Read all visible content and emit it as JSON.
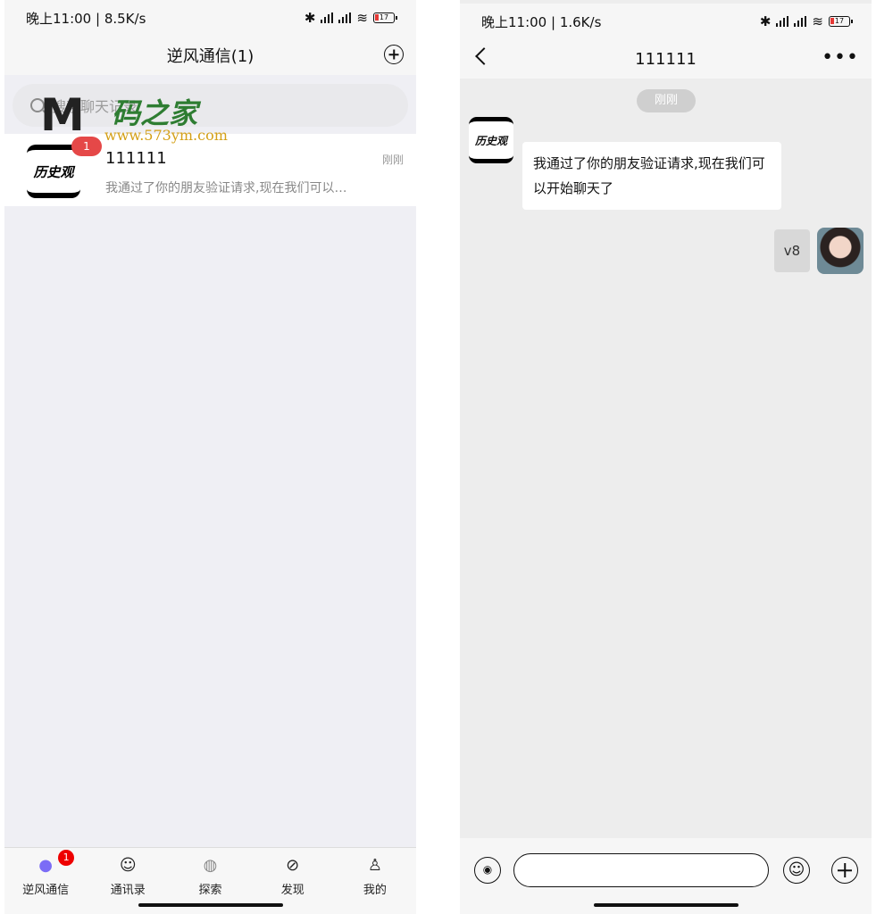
{
  "left": {
    "status": {
      "time": "晚上11:00",
      "speed": "8.5K/s",
      "battery": "17"
    },
    "header": {
      "title": "逆风通信(1)"
    },
    "search": {
      "placeholder": "搜索聊天记录"
    },
    "watermark": {
      "title": "码之家",
      "url": "www.573ym.com"
    },
    "chat_list": [
      {
        "name": "111111",
        "time": "刚刚",
        "preview": "我通过了你的朋友验证请求,现在我们可以…",
        "unread": "1",
        "avatar_text": "历史观"
      }
    ],
    "tabs": [
      {
        "label": "逆风通信",
        "icon": "chat-bubble-icon",
        "badge": "1"
      },
      {
        "label": "通讯录",
        "icon": "contacts-icon"
      },
      {
        "label": "探索",
        "icon": "planet-icon"
      },
      {
        "label": "发现",
        "icon": "compass-icon"
      },
      {
        "label": "我的",
        "icon": "profile-icon"
      }
    ]
  },
  "right": {
    "status": {
      "time": "晚上11:00",
      "speed": "1.6K/s",
      "battery": "17"
    },
    "header": {
      "title": "111111"
    },
    "time_pill": "刚刚",
    "messages": [
      {
        "side": "in",
        "avatar_text": "历史观",
        "text": "我通过了你的朋友验证请求,现在我们可以开始聊天了"
      },
      {
        "side": "out",
        "text": "v8"
      }
    ]
  },
  "colors": {
    "badge": "#e54848",
    "tab_badge": "#ee0000",
    "page_bg": "#efeff4"
  }
}
